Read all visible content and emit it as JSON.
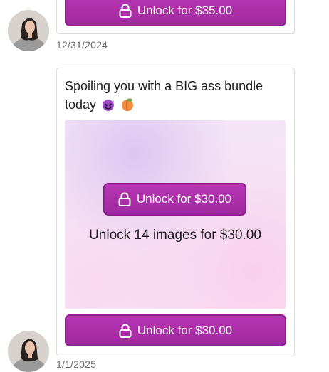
{
  "messages": [
    {
      "unlock_button_label": "Unlock for $35.00",
      "timestamp": "12/31/2024"
    },
    {
      "text": "Spoiling you with a BIG ass bundle today",
      "emojis": [
        "smiling-devil-emoji",
        "peach-emoji"
      ],
      "preview": {
        "button_label": "Unlock for $30.00",
        "caption": "Unlock 14 images for $30.00"
      },
      "unlock_button_label": "Unlock for $30.00",
      "timestamp": "1/1/2025"
    }
  ],
  "colors": {
    "button": "#a92fa7",
    "button_border": "#8f1f8e",
    "timestamp": "#6b6b6b",
    "card_border": "#dcdcdc"
  },
  "icons": [
    "lock-icon",
    "avatar"
  ]
}
